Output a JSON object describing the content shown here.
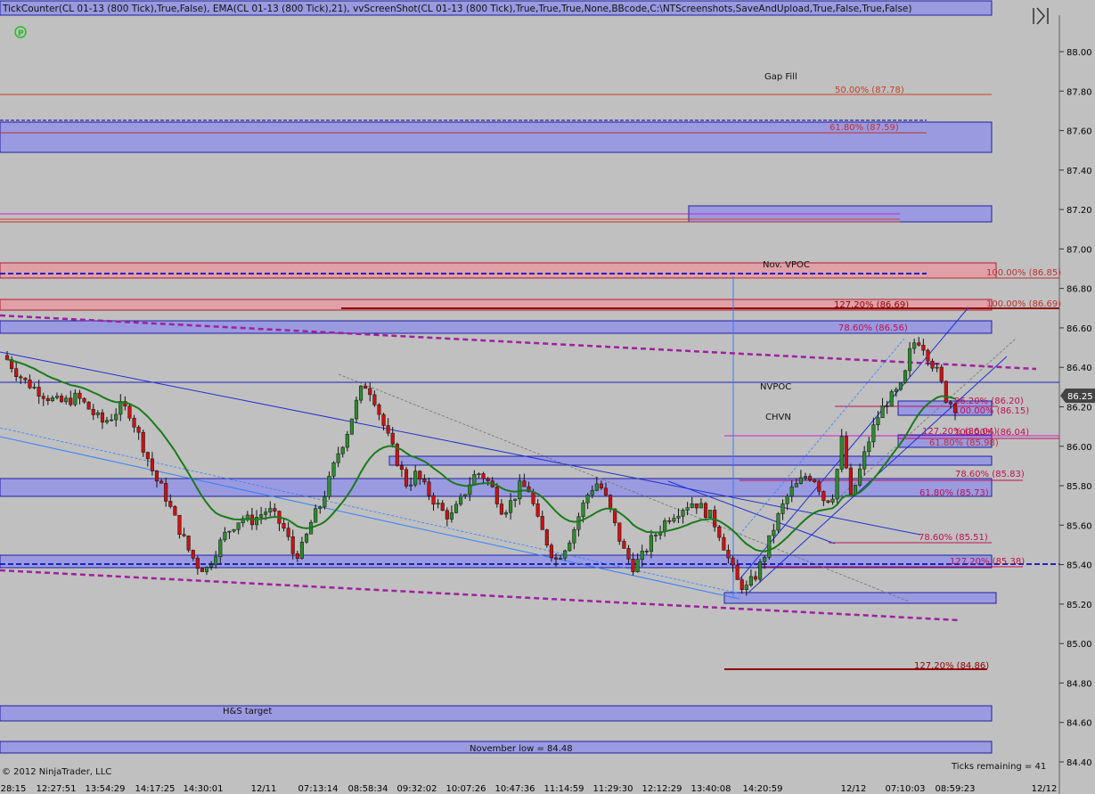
{
  "header": {
    "indicator_text": "TickCounter(CL 01-13 (800 Tick),True,False), EMA(CL 01-13 (800 Tick),21), vvScreenShot(CL 01-13 (800 Tick),True,True,True,None,BBcode,C:\\NTScreenshots,SaveAndUpload,True,False,True,False)",
    "p_icon": "circle-p-icon",
    "pin_icon": "pin-icon"
  },
  "footer": {
    "copyright": "© 2012 NinjaTrader, LLC",
    "ticks_remaining": "Ticks remaining = 41"
  },
  "colors": {
    "background": "#c0c0c0",
    "zone_blue": "#9a9ae0",
    "zone_red": "#e0a0a8",
    "ema": "#1a7a1a",
    "candle_up": "#2e8b2e",
    "candle_down": "#cc1111",
    "price_tag": "#444444"
  },
  "chart_data": {
    "type": "candlestick",
    "symbol": "CL 01-13 (800 Tick)",
    "ylim": [
      84.32,
      88.18
    ],
    "y_ticks": [
      "88.00",
      "87.80",
      "87.60",
      "87.40",
      "87.20",
      "87.00",
      "86.80",
      "86.60",
      "86.40",
      "86.20",
      "86.00",
      "85.80",
      "85.60",
      "85.40",
      "85.20",
      "85.00",
      "84.80",
      "84.60",
      "84.40"
    ],
    "x_ticks": [
      "28:15",
      "12:27:51",
      "13:54:29",
      "14:17:25",
      "14:30:01",
      "12/11",
      "07:13:14",
      "08:58:34",
      "09:32:02",
      "10:07:26",
      "10:47:36",
      "11:14:59",
      "11:29:30",
      "12:12:29",
      "13:40:08",
      "14:20:59",
      "12/12",
      "07:10:03",
      "08:59:23",
      "12/12"
    ],
    "last_price": "86.25",
    "ema_period": 21,
    "close_series": [
      86.44,
      86.38,
      86.33,
      86.3,
      86.27,
      86.24,
      86.22,
      86.23,
      86.25,
      86.21,
      86.16,
      86.12,
      86.15,
      86.2,
      86.18,
      86.07,
      85.96,
      85.84,
      85.77,
      85.66,
      85.56,
      85.46,
      85.39,
      85.38,
      85.47,
      85.55,
      85.6,
      85.64,
      85.62,
      85.65,
      85.68,
      85.63,
      85.57,
      85.44,
      85.49,
      85.62,
      85.7,
      85.82,
      85.96,
      86.06,
      86.2,
      86.32,
      86.27,
      86.14,
      86.02,
      85.91,
      85.8,
      85.86,
      85.79,
      85.73,
      85.67,
      85.64,
      85.71,
      85.8,
      85.87,
      85.84,
      85.77,
      85.67,
      85.72,
      85.8,
      85.78,
      85.62,
      85.52,
      85.42,
      85.48,
      85.56,
      85.68,
      85.78,
      85.82,
      85.72,
      85.58,
      85.46,
      85.39,
      85.44,
      85.52,
      85.58,
      85.64,
      85.67,
      85.7,
      85.72,
      85.68,
      85.64,
      85.55,
      85.42,
      85.31,
      85.28,
      85.34,
      85.44,
      85.57,
      85.68,
      85.77,
      85.81,
      85.86,
      85.83,
      85.72,
      85.76,
      86.04,
      85.73,
      85.87,
      86.02,
      86.14,
      86.22,
      86.26,
      86.31,
      86.52,
      86.54,
      86.45,
      86.37,
      86.24,
      86.2
    ],
    "levels": [
      {
        "label": "50.00% (87.78)",
        "value": 87.78,
        "color": "#c04020"
      },
      {
        "label": "61.80% (87.59)",
        "value": 87.59,
        "color": "#c03030"
      },
      {
        "label": "78.60% (86.56)",
        "value": 86.56,
        "color": "#c01050"
      },
      {
        "label": "127.20% (86.69)",
        "value": 86.69,
        "color": "#900000"
      },
      {
        "label": "100.00% (86.85)",
        "value": 86.85,
        "color": "#c03030"
      },
      {
        "label": "100.00% (86.69)",
        "value": 86.69,
        "color": "#c03030"
      },
      {
        "label": "86.20% (86.20)",
        "value": 86.2,
        "color": "#c01050"
      },
      {
        "label": "100.00% (86.15)",
        "value": 86.15,
        "color": "#c01050"
      },
      {
        "label": "127.20% (86.04)",
        "value": 86.04,
        "color": "#c01050"
      },
      {
        "label": "100.00% (86.04)",
        "value": 86.04,
        "color": "#c01050"
      },
      {
        "label": "61.80% (85.98)",
        "value": 85.98,
        "color": "#c03030"
      },
      {
        "label": "78.60% (85.83)",
        "value": 85.83,
        "color": "#c01050"
      },
      {
        "label": "61.80% (85.73)",
        "value": 85.73,
        "color": "#c01050"
      },
      {
        "label": "78.60% (85.51)",
        "value": 85.51,
        "color": "#c01050"
      },
      {
        "label": "127.20% (85.38)",
        "value": 85.38,
        "color": "#c01050"
      },
      {
        "label": "127.20% (84.86)",
        "value": 84.86,
        "color": "#900000"
      }
    ],
    "annotations": [
      "Gap Fill",
      "Nov. VPOC",
      "NVPOC",
      "CHVN",
      "H&S target",
      "November low = 84.48"
    ]
  }
}
